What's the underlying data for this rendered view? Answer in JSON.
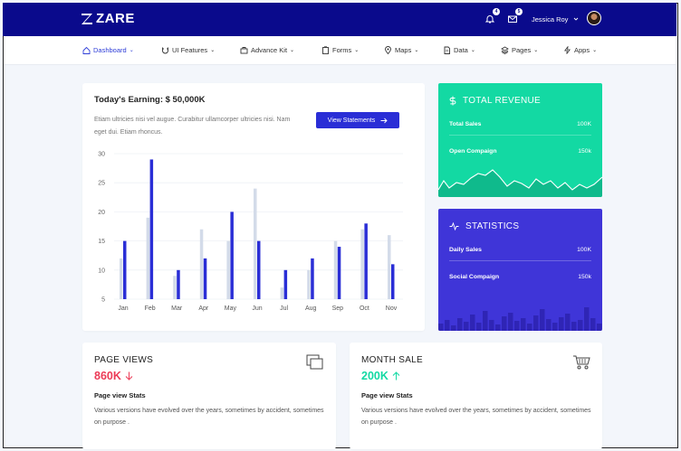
{
  "brand": {
    "name": "ZARE"
  },
  "header": {
    "notification_count": "4",
    "message_count": "5",
    "user_name": "Jessica Roy"
  },
  "nav": {
    "items": [
      {
        "label": "Dashboard",
        "icon": "home-icon",
        "active": true
      },
      {
        "label": "UI Features",
        "icon": "magnet-icon"
      },
      {
        "label": "Advance Kit",
        "icon": "briefcase-icon"
      },
      {
        "label": "Forms",
        "icon": "clipboard-icon"
      },
      {
        "label": "Maps",
        "icon": "map-pin-icon"
      },
      {
        "label": "Data",
        "icon": "file-icon"
      },
      {
        "label": "Pages",
        "icon": "layers-icon"
      },
      {
        "label": "Apps",
        "icon": "bolt-icon"
      }
    ]
  },
  "earnings": {
    "title": "Today's Earning: $ 50,000K",
    "description": "Etiam ultricies nisi vel augue. Curabitur ullamcorper ultricies nisi. Nam eget dui. Etiam rhoncus.",
    "button_label": "View Statements"
  },
  "chart_data": {
    "type": "bar",
    "categories": [
      "Jan",
      "Feb",
      "Mar",
      "Apr",
      "May",
      "Jun",
      "Jul",
      "Aug",
      "Sep",
      "Oct",
      "Nov"
    ],
    "series": [
      {
        "values": [
          12,
          19,
          9,
          17,
          15,
          24,
          7,
          10,
          15,
          17,
          16
        ],
        "color": "#d3dbe9"
      },
      {
        "values": [
          15,
          29,
          10,
          12,
          20,
          15,
          10,
          12,
          14,
          18,
          11
        ],
        "color": "#2a2ed6"
      }
    ],
    "yticks": [
      5,
      10,
      15,
      20,
      25,
      30
    ],
    "ylim": [
      5,
      30
    ],
    "grid": true
  },
  "revenue": {
    "title": "TOTAL REVENUE",
    "icon": "dollar-icon",
    "color": "#13d9a3",
    "rows": [
      {
        "label": "Total Sales",
        "value": "100K"
      },
      {
        "label": "Open Compaign",
        "value": "150k"
      }
    ]
  },
  "statistics": {
    "title": "STATISTICS",
    "icon": "activity-icon",
    "color": "#3f35d8",
    "rows": [
      {
        "label": "Daily Sales",
        "value": "100K"
      },
      {
        "label": "Social Compaign",
        "value": "150k"
      }
    ]
  },
  "page_views": {
    "title": "PAGE VIEWS",
    "value": "860K",
    "trend": "down",
    "color": "#ec3b57",
    "subtitle": "Page view Stats",
    "description": "Various versions have evolved over the years, sometimes by accident, sometimes on purpose .",
    "icon": "copy-icon"
  },
  "month_sale": {
    "title": "MONTH SALE",
    "value": "200K",
    "trend": "up",
    "color": "#13d9a3",
    "subtitle": "Page view Stats",
    "description": "Various versions have evolved over the years, sometimes by accident, sometimes on purpose .",
    "icon": "cart-icon"
  }
}
